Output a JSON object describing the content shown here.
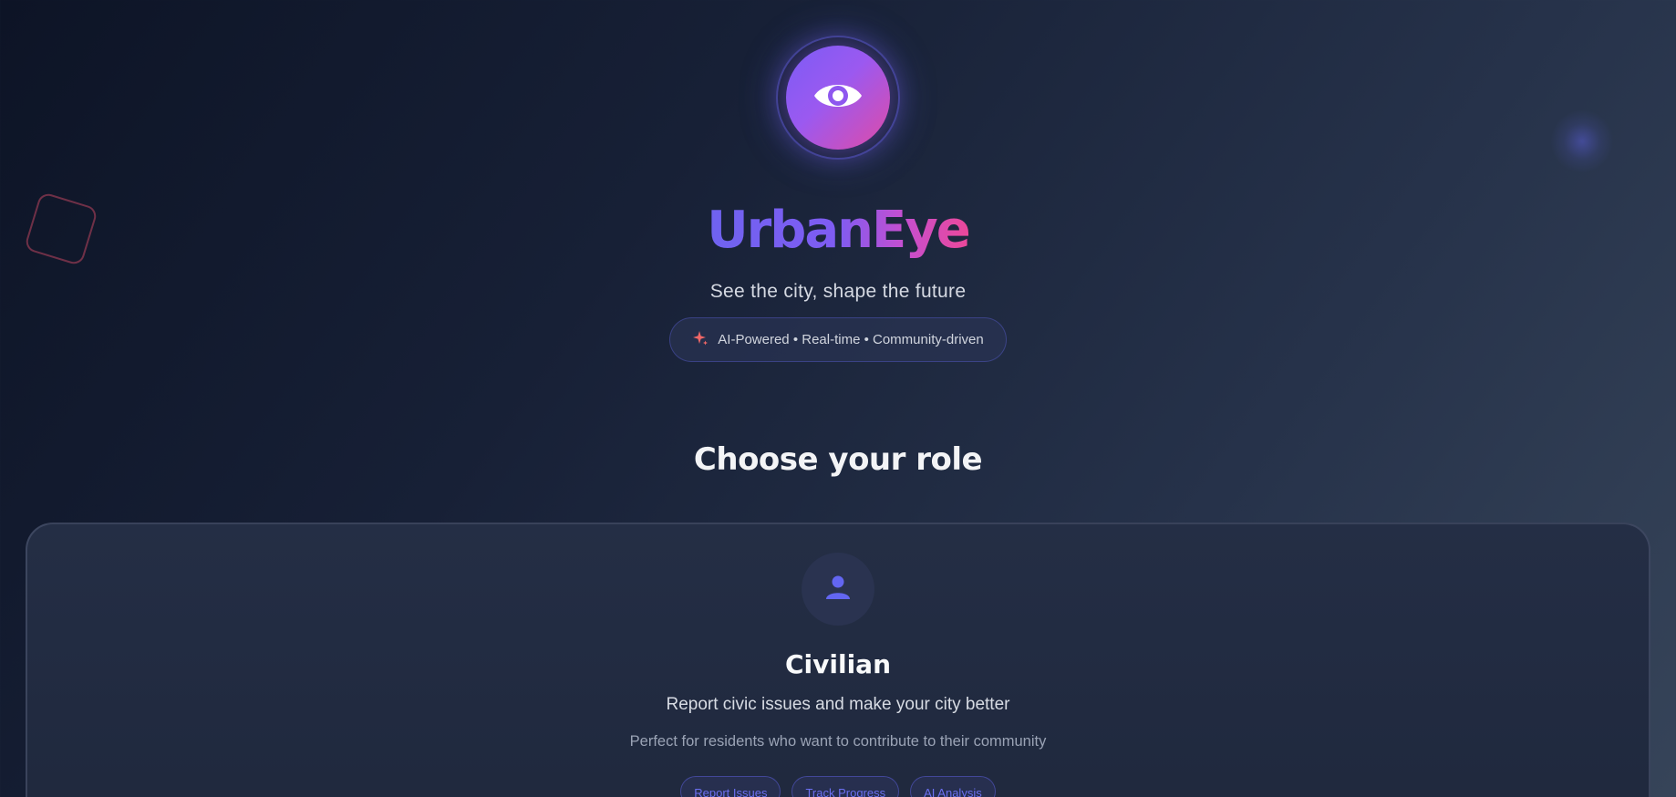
{
  "brand": {
    "name": "UrbanEye",
    "tagline": "See the city, shape the future",
    "features_pill": "AI-Powered • Real-time • Community-driven",
    "logo_icon": "eye-icon",
    "pill_icon": "sparkle-icon"
  },
  "roles_section": {
    "title": "Choose your role"
  },
  "role_card": {
    "icon": "user-icon",
    "title": "Civilian",
    "description": "Report civic issues and make your city better",
    "subtext": "Perfect for residents who want to contribute to their community",
    "tags": [
      "Report Issues",
      "Track Progress",
      "AI Analysis"
    ]
  },
  "colors": {
    "accent": "#6366f1",
    "brand_gradient_start": "#6f63f0",
    "brand_gradient_end": "#ec4899",
    "decoration_square": "#be465f"
  }
}
